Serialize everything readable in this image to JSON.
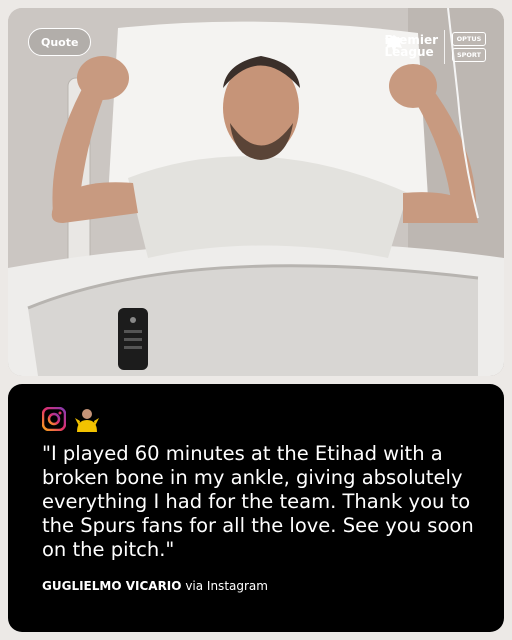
{
  "header": {
    "quote_label": "Quote",
    "league_line1": "Premier",
    "league_line2": "League",
    "broadcaster_line1": "OPTUS",
    "broadcaster_line2": "SPORT"
  },
  "photo": {
    "subject": "player-in-hospital-bed-icon"
  },
  "quote": {
    "text": "\"I played 60 minutes at the Etihad with a broken bone in my ankle, giving absolutely everything I had for the team. Thank you to the Spurs fans for all the love. See you soon on the pitch.\"",
    "author": "GUGLIELMO VICARIO",
    "source": "via Instagram"
  },
  "colors": {
    "card_bg": "#000000",
    "text": "#ffffff",
    "instagram": "#e1306c",
    "badge": "#f2c200"
  }
}
